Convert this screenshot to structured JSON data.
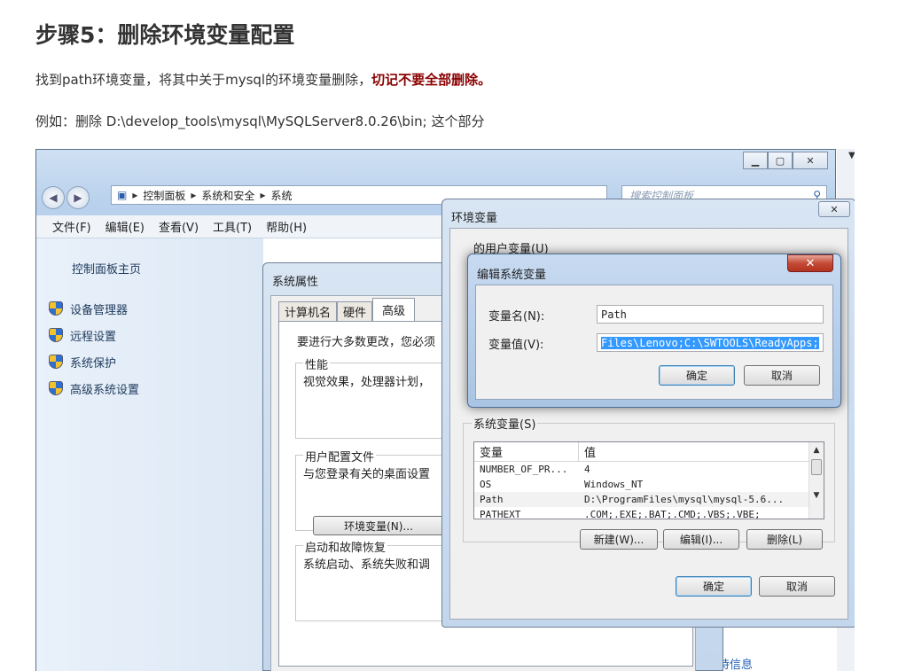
{
  "article": {
    "heading": "步骤5：删除环境变量配置",
    "para1_text": "找到path环境变量，将其中关于mysql的环境变量删除，",
    "para1_warning": "切记不要全部删除。",
    "para2": "例如：删除 D:\\develop_tools\\mysql\\MySQLServer8.0.26\\bin; 这个部分"
  },
  "main_window": {
    "breadcrumb": [
      "控制面板",
      "系统和安全",
      "系统"
    ],
    "search_placeholder": "搜索控制面板",
    "menu": [
      "文件(F)",
      "编辑(E)",
      "查看(V)",
      "工具(T)",
      "帮助(H)"
    ],
    "home_link": "控制面板主页",
    "tasks": [
      "设备管理器",
      "远程设置",
      "系统保护",
      "高级系统设置"
    ],
    "support_link": "支持信息"
  },
  "system_properties": {
    "title": "系统属性",
    "tabs": [
      "计算机名",
      "硬件",
      "高级"
    ],
    "intro": "要进行大多数更改，您必须",
    "perf_label": "性能",
    "perf_text": "视觉效果，处理器计划，",
    "profile_label": "用户配置文件",
    "profile_text": "与您登录有关的桌面设置",
    "startup_label": "启动和故障恢复",
    "startup_text": "系统启动、系统失败和调",
    "env_button": "环境变量(N)..."
  },
  "env_vars": {
    "title": "环境变量",
    "user_vars_label": "的用户变量(U)",
    "system_vars_label": "系统变量(S)",
    "col_var": "变量",
    "col_val": "值",
    "rows": [
      {
        "name": "NUMBER_OF_PR...",
        "value": "4"
      },
      {
        "name": "OS",
        "value": "Windows_NT"
      },
      {
        "name": "Path",
        "value": "D:\\ProgramFiles\\mysql\\mysql-5.6..."
      },
      {
        "name": "PATHEXT",
        "value": ".COM;.EXE;.BAT;.CMD;.VBS;.VBE;"
      }
    ],
    "new_btn": "新建(W)...",
    "edit_btn": "编辑(I)...",
    "delete_btn": "删除(L)",
    "ok_btn": "确定",
    "cancel_btn": "取消"
  },
  "edit_dialog": {
    "title": "编辑系统变量",
    "name_label": "变量名(N):",
    "name_value": "Path",
    "value_label": "变量值(V):",
    "value_value": "Files\\Lenovo;C:\\SWTOOLS\\ReadyApps;",
    "ok_btn": "确定",
    "cancel_btn": "取消"
  }
}
